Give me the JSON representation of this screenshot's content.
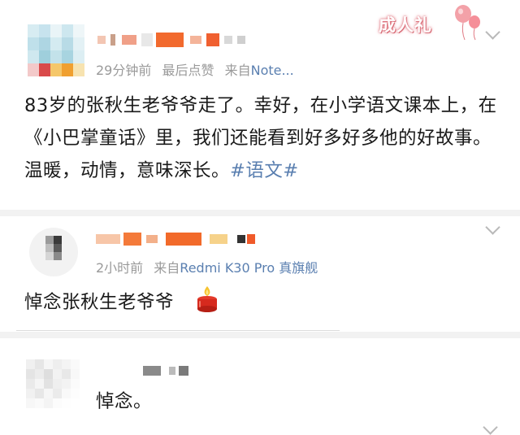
{
  "main_post": {
    "meta_time": "29分钟前",
    "meta_like": "最后点赞",
    "meta_source_prefix": "来自",
    "meta_source": "Note...",
    "text": "83岁的张秋生老爷爷走了。幸好，在小学语文课本上，在《小巴掌童话》里，我们还能看到好多好多他的好故事。温暖，动情，意味深长。",
    "hashtag": "#语文#",
    "badge_text": "成人礼"
  },
  "reply_1": {
    "meta_time": "2小时前",
    "meta_source_prefix": "来自",
    "meta_source": "Redmi K30 Pro 真旗舰",
    "text": "悼念张秋生老爷爷"
  },
  "reply_2": {
    "text": "悼念。"
  },
  "icons": {
    "more": "chevron-down-icon",
    "candle": "candle-emoji-icon",
    "balloons": "balloon-icon"
  },
  "colors": {
    "link": "#5a7fb0",
    "meta": "#9a9a9a",
    "badge": "#e07a84"
  }
}
